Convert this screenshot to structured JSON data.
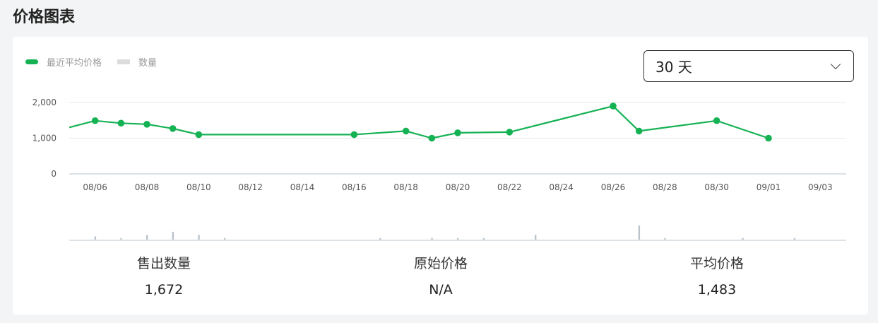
{
  "page": {
    "title": "价格图表"
  },
  "legend": [
    {
      "label": "最近平均价格",
      "color": "#15b254"
    },
    {
      "label": "数量",
      "color": "#dcdcdc"
    }
  ],
  "range_select": {
    "value": "30 天",
    "icon": "chevron-down-icon"
  },
  "stats": [
    {
      "label": "售出数量",
      "value": "1,672"
    },
    {
      "label": "原始价格",
      "value": "N/A"
    },
    {
      "label": "平均价格",
      "value": "1,483"
    }
  ],
  "chart_data": {
    "type": "line",
    "x_start": "08/05",
    "x_end": "09/04",
    "x_tick_labels": [
      "08/06",
      "08/08",
      "08/10",
      "08/12",
      "08/14",
      "08/16",
      "08/18",
      "08/20",
      "08/22",
      "08/24",
      "08/26",
      "08/28",
      "08/30",
      "09/01",
      "09/03"
    ],
    "y_tick_labels": [
      "0",
      "1,000",
      "2,000"
    ],
    "ylim": [
      0,
      2000
    ],
    "grid": true,
    "legend_position": "top-left",
    "series": [
      {
        "name": "最近平均价格",
        "color": "#15b254",
        "line_start": {
          "x": "08/05",
          "y": 1300
        },
        "points": [
          {
            "x": "08/06",
            "y": 1490
          },
          {
            "x": "08/07",
            "y": 1420
          },
          {
            "x": "08/08",
            "y": 1390
          },
          {
            "x": "08/09",
            "y": 1270
          },
          {
            "x": "08/10",
            "y": 1100
          },
          {
            "x": "08/16",
            "y": 1100
          },
          {
            "x": "08/18",
            "y": 1200
          },
          {
            "x": "08/19",
            "y": 1000
          },
          {
            "x": "08/20",
            "y": 1150
          },
          {
            "x": "08/22",
            "y": 1170
          },
          {
            "x": "08/26",
            "y": 1900
          },
          {
            "x": "08/27",
            "y": 1200
          },
          {
            "x": "08/30",
            "y": 1490
          },
          {
            "x": "09/01",
            "y": 1000
          }
        ]
      },
      {
        "name": "数量",
        "color": "#bcc3cb",
        "points": [
          {
            "x": "08/06",
            "y": 2
          },
          {
            "x": "08/07",
            "y": 1
          },
          {
            "x": "08/08",
            "y": 3
          },
          {
            "x": "08/09",
            "y": 5
          },
          {
            "x": "08/10",
            "y": 3
          },
          {
            "x": "08/11",
            "y": 1
          },
          {
            "x": "08/17",
            "y": 1
          },
          {
            "x": "08/19",
            "y": 1
          },
          {
            "x": "08/20",
            "y": 1
          },
          {
            "x": "08/21",
            "y": 1
          },
          {
            "x": "08/23",
            "y": 3
          },
          {
            "x": "08/27",
            "y": 9
          },
          {
            "x": "08/28",
            "y": 1
          },
          {
            "x": "08/31",
            "y": 1
          },
          {
            "x": "09/02",
            "y": 1
          }
        ]
      }
    ]
  }
}
